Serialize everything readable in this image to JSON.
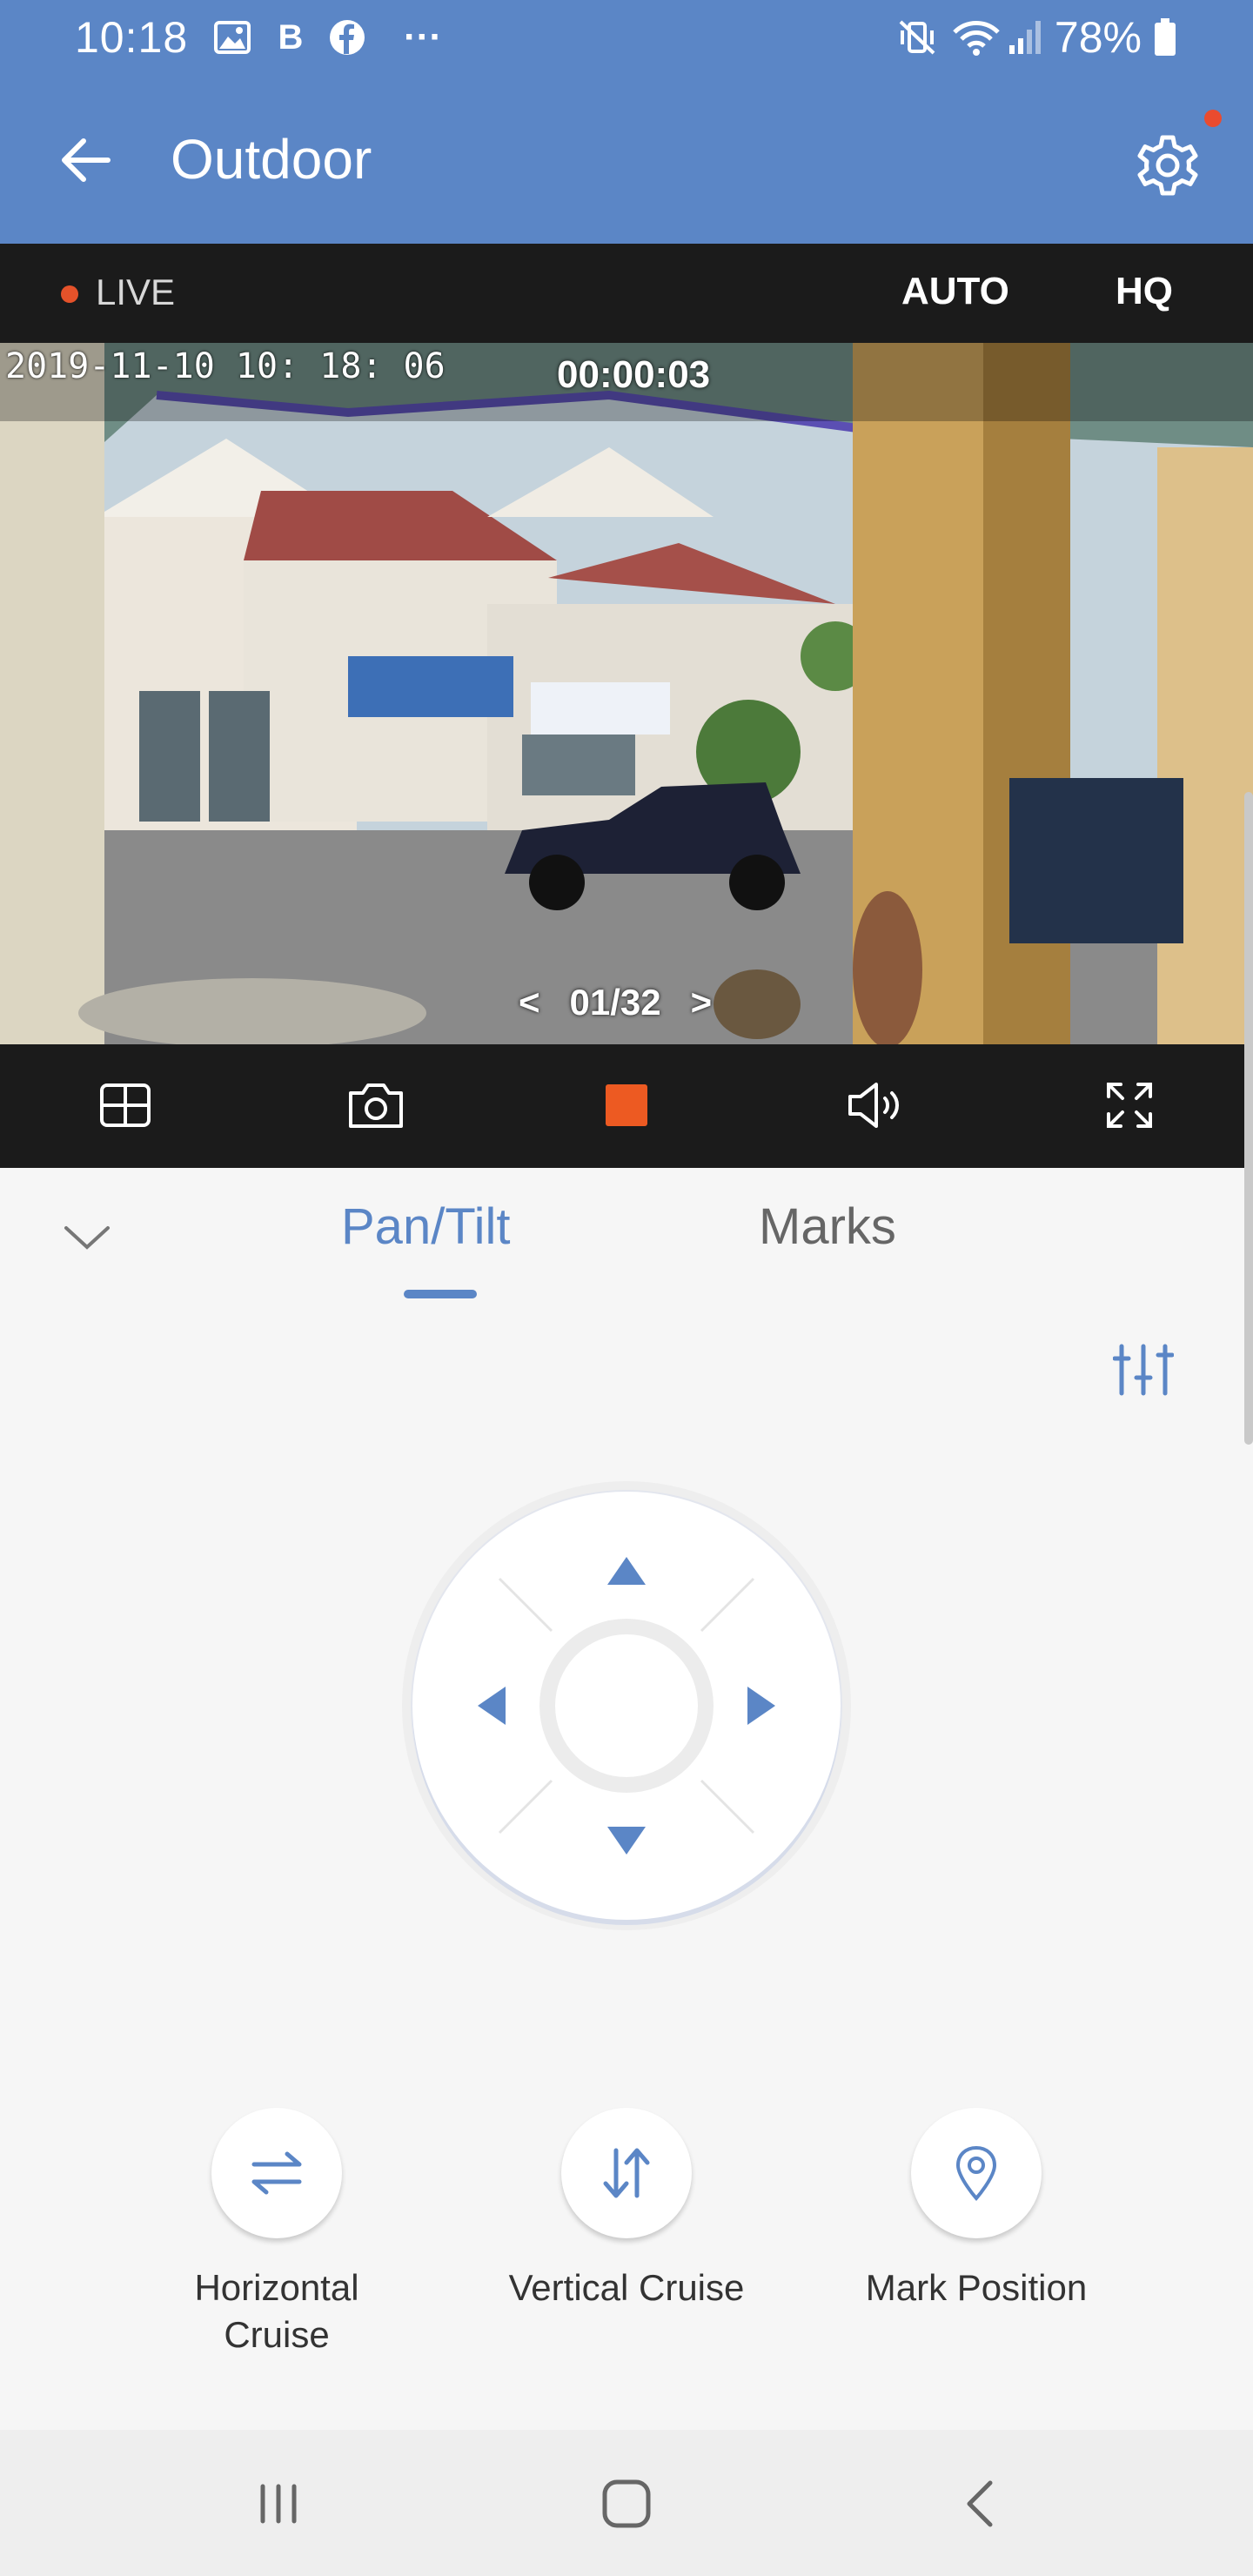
{
  "status_bar": {
    "time": "10:18",
    "battery": "78%",
    "icons": [
      "gallery-icon",
      "b-app-icon",
      "facebook-icon",
      "more-dots-icon",
      "mute-vibrate-icon",
      "wifi-icon",
      "signal-icon",
      "battery-icon"
    ]
  },
  "app_bar": {
    "title": "Outdoor",
    "back_icon": "arrow-left-icon",
    "settings_icon": "gear-icon",
    "notification_dot_color": "#ea4b2f",
    "background_color": "#5b86c6"
  },
  "live_bar": {
    "live_label": "LIVE",
    "quality_auto": "AUTO",
    "quality_hq": "HQ",
    "live_dot_color": "#e5522a"
  },
  "video": {
    "timestamp": "2019-11-10  10: 18: 06",
    "recording_timer": "00:00:03",
    "channel_prev": "<",
    "channel": "01/32",
    "channel_next": ">"
  },
  "toolbar": {
    "icons": [
      "multi-view-grid-icon",
      "snapshot-camera-icon",
      "stop-recording-icon",
      "speaker-icon",
      "fullscreen-icon"
    ],
    "record_color": "#ed5a22"
  },
  "panel": {
    "collapse_icon": "chevron-down-icon",
    "tabs": [
      {
        "label": "Pan/Tilt",
        "active": true
      },
      {
        "label": "Marks",
        "active": false
      }
    ],
    "adjust_icon": "sliders-icon",
    "joystick": {
      "directions": [
        "up",
        "left",
        "right",
        "down"
      ],
      "arrow_color": "#5b86c6"
    },
    "actions": [
      {
        "label": "Horizontal Cruise",
        "icon": "horizontal-swap-arrows-icon"
      },
      {
        "label": "Vertical Cruise",
        "icon": "vertical-swap-arrows-icon"
      },
      {
        "label": "Mark Position",
        "icon": "location-pin-icon"
      }
    ]
  },
  "nav_bar": {
    "icons": [
      "recent-apps-icon",
      "home-icon",
      "back-icon"
    ]
  }
}
